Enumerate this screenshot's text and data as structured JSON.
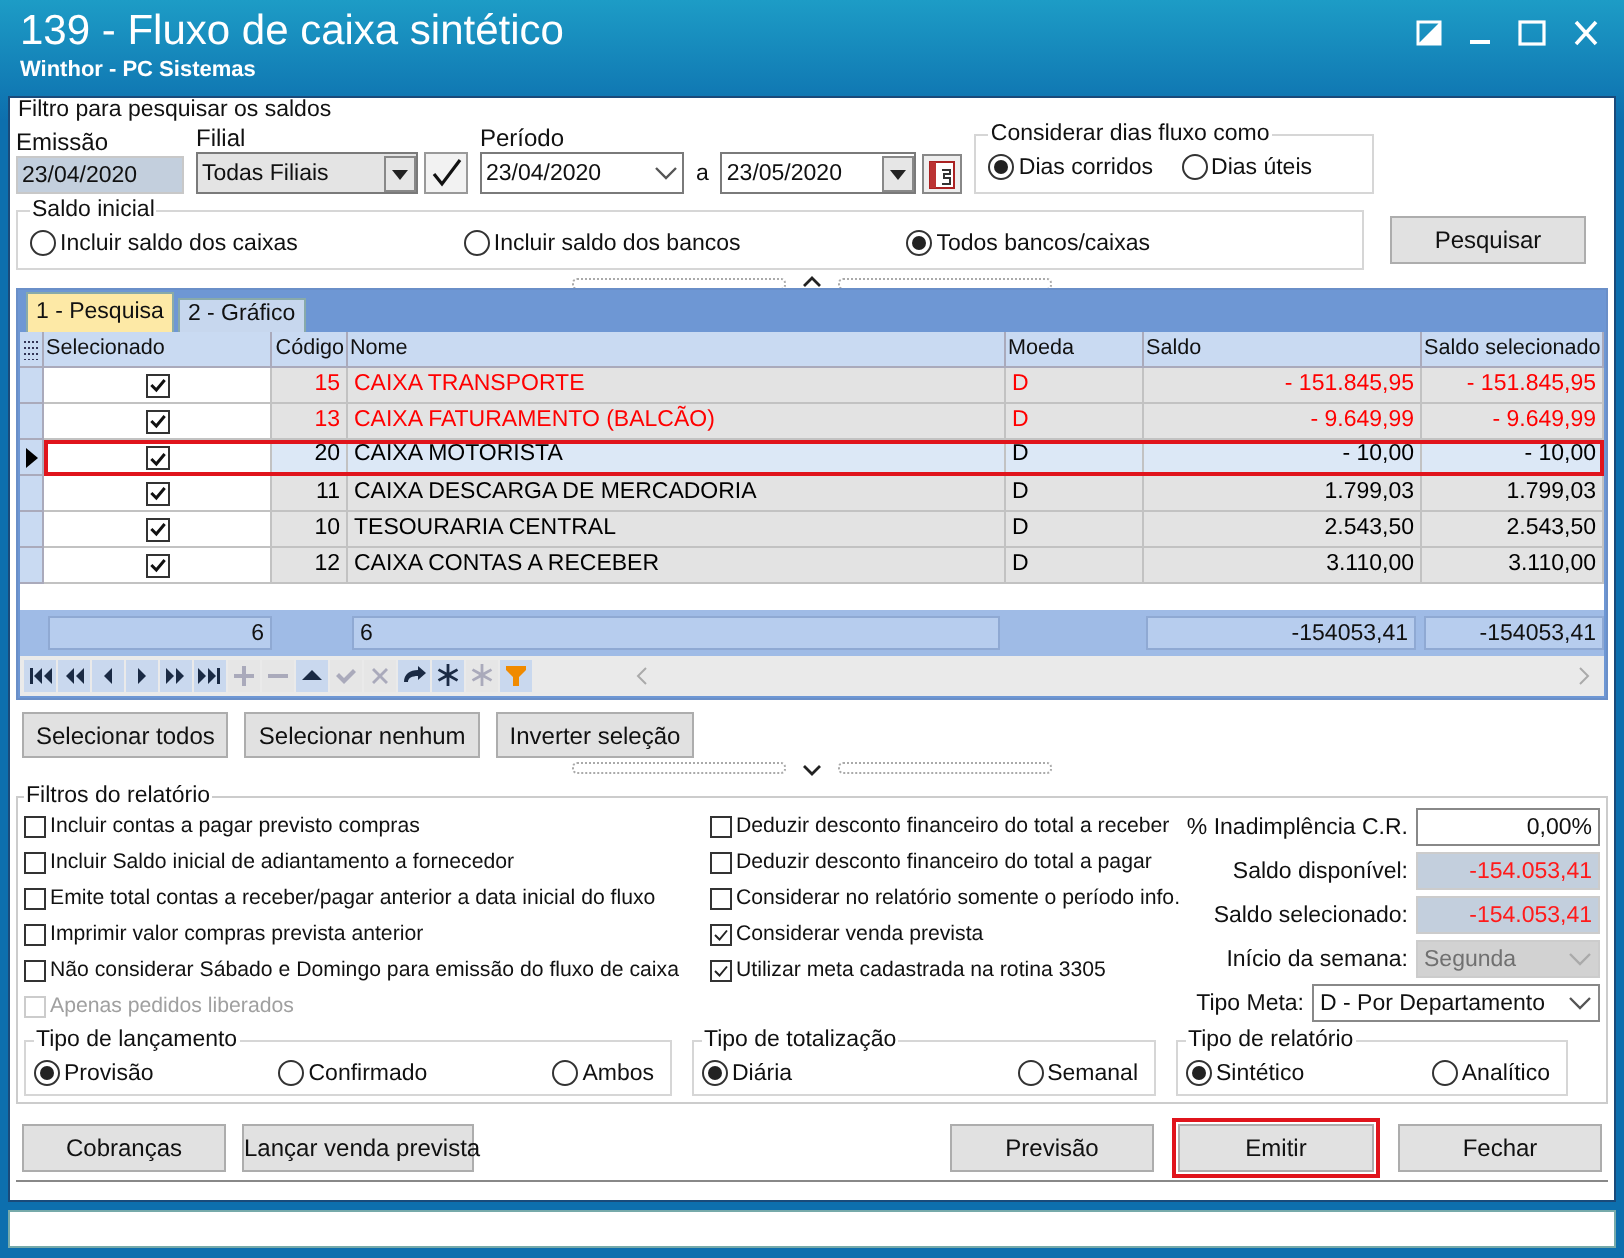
{
  "window": {
    "title": "139 - Fluxo de caixa sintético",
    "subtitle": "Winthor - PC Sistemas"
  },
  "search_filter": {
    "title": "Filtro para pesquisar os saldos",
    "emissao": {
      "label": "Emissão",
      "value": "23/04/2020"
    },
    "filial": {
      "label": "Filial",
      "value": "Todas Filiais"
    },
    "periodo": {
      "label": "Período",
      "from": "23/04/2020",
      "separator": "a",
      "to": "23/05/2020"
    },
    "dias_fluxo": {
      "title": "Considerar dias fluxo como",
      "options": [
        {
          "label": "Dias corridos",
          "selected": true
        },
        {
          "label": "Dias úteis",
          "selected": false
        }
      ]
    },
    "saldo_inicial": {
      "title": "Saldo inicial",
      "options": [
        {
          "label": "Incluir saldo dos caixas",
          "selected": false
        },
        {
          "label": "Incluir saldo dos bancos",
          "selected": false
        },
        {
          "label": "Todos bancos/caixas",
          "selected": true
        }
      ]
    },
    "search_button": "Pesquisar"
  },
  "tabs": [
    {
      "label": "1 - Pesquisa",
      "selected": true
    },
    {
      "label": "2 - Gráfico",
      "selected": false
    }
  ],
  "table": {
    "columns": [
      "Selecionado",
      "Código",
      "Nome",
      "Moeda",
      "Saldo",
      "Saldo selecionado"
    ],
    "rows": [
      {
        "checked": true,
        "code": "15",
        "name": "CAIXA TRANSPORTE",
        "currency": "D",
        "balance": "- 151.845,95",
        "selected_balance": "- 151.845,95",
        "color": "#ff0000",
        "current": false,
        "outlined": false
      },
      {
        "checked": true,
        "code": "13",
        "name": "CAIXA FATURAMENTO (BALCÃO)",
        "currency": "D",
        "balance": "- 9.649,99",
        "selected_balance": "- 9.649,99",
        "color": "#ff0000",
        "current": false,
        "outlined": false
      },
      {
        "checked": true,
        "code": "20",
        "name": "CAIXA MOTORISTA",
        "currency": "D",
        "balance": "- 10,00",
        "selected_balance": "- 10,00",
        "color": "#000000",
        "current": true,
        "outlined": true
      },
      {
        "checked": true,
        "code": "11",
        "name": "CAIXA DESCARGA DE MERCADORIA",
        "currency": "D",
        "balance": "1.799,03",
        "selected_balance": "1.799,03",
        "color": "#000000",
        "current": false,
        "outlined": false
      },
      {
        "checked": true,
        "code": "10",
        "name": "TESOURARIA CENTRAL",
        "currency": "D",
        "balance": "2.543,50",
        "selected_balance": "2.543,50",
        "color": "#000000",
        "current": false,
        "outlined": false
      },
      {
        "checked": true,
        "code": "12",
        "name": "CAIXA CONTAS A RECEBER",
        "currency": "D",
        "balance": "3.110,00",
        "selected_balance": "3.110,00",
        "color": "#000000",
        "current": false,
        "outlined": false
      }
    ],
    "totals": {
      "count": "6",
      "name_count": "6",
      "balance": "-154053,41",
      "selected_balance": "-154053,41"
    }
  },
  "grid_buttons": [
    "Selecionar todos",
    "Selecionar nenhum",
    "Inverter seleção"
  ],
  "report_filters": {
    "title": "Filtros do relatório",
    "checks_left": [
      {
        "label": "Incluir contas a pagar previsto compras",
        "checked": false,
        "disabled": false
      },
      {
        "label": "Incluir Saldo inicial de adiantamento a fornecedor",
        "checked": false,
        "disabled": false
      },
      {
        "label": "Emite total contas a receber/pagar anterior a data inicial do fluxo",
        "checked": false,
        "disabled": false
      },
      {
        "label": "Imprimir valor compras prevista anterior",
        "checked": false,
        "disabled": false
      },
      {
        "label": "Não considerar Sábado e Domingo para emissão do fluxo de caixa",
        "checked": false,
        "disabled": false
      },
      {
        "label": "Apenas pedidos liberados",
        "checked": false,
        "disabled": true
      }
    ],
    "checks_right": [
      {
        "label": "Deduzir desconto financeiro do total a receber",
        "checked": false,
        "disabled": false
      },
      {
        "label": "Deduzir desconto financeiro do total a pagar",
        "checked": false,
        "disabled": false
      },
      {
        "label": "Considerar no relatório somente o período info.",
        "checked": false,
        "disabled": false
      },
      {
        "label": "Considerar venda prevista",
        "checked": true,
        "disabled": false
      },
      {
        "label": "Utilizar meta cadastrada na rotina 3305",
        "checked": true,
        "disabled": false
      }
    ],
    "fields": [
      {
        "kind": "input",
        "label": "% Inadimplência C.R.",
        "value": "0,00%",
        "negative": false,
        "disabled": false
      },
      {
        "kind": "readonly",
        "label": "Saldo disponível:",
        "value": "-154.053,41",
        "negative": true,
        "disabled": false
      },
      {
        "kind": "readonly",
        "label": "Saldo selecionado:",
        "value": "-154.053,41",
        "negative": true,
        "disabled": false
      },
      {
        "kind": "select",
        "label": "Início da semana:",
        "value": "Segunda",
        "negative": false,
        "disabled": true
      }
    ],
    "tipo_meta": {
      "label": "Tipo Meta:",
      "value": "D - Por Departamento"
    },
    "groups": [
      {
        "title": "Tipo de lançamento",
        "options": [
          {
            "label": "Provisão",
            "selected": true
          },
          {
            "label": "Confirmado",
            "selected": false
          },
          {
            "label": "Ambos",
            "selected": false
          }
        ]
      },
      {
        "title": "Tipo de totalização",
        "options": [
          {
            "label": "Diária",
            "selected": true
          },
          {
            "label": "Semanal",
            "selected": false
          }
        ]
      },
      {
        "title": "Tipo de relatório",
        "options": [
          {
            "label": "Sintético",
            "selected": true
          },
          {
            "label": "Analítico",
            "selected": false
          }
        ]
      }
    ]
  },
  "footer_buttons": [
    {
      "label": "Cobranças",
      "outlined": false
    },
    {
      "label": "Lançar venda prevista",
      "outlined": false
    },
    {
      "label": "Previsão",
      "outlined": false
    },
    {
      "label": "Emitir",
      "outlined": true
    },
    {
      "label": "Fechar",
      "outlined": false
    }
  ]
}
